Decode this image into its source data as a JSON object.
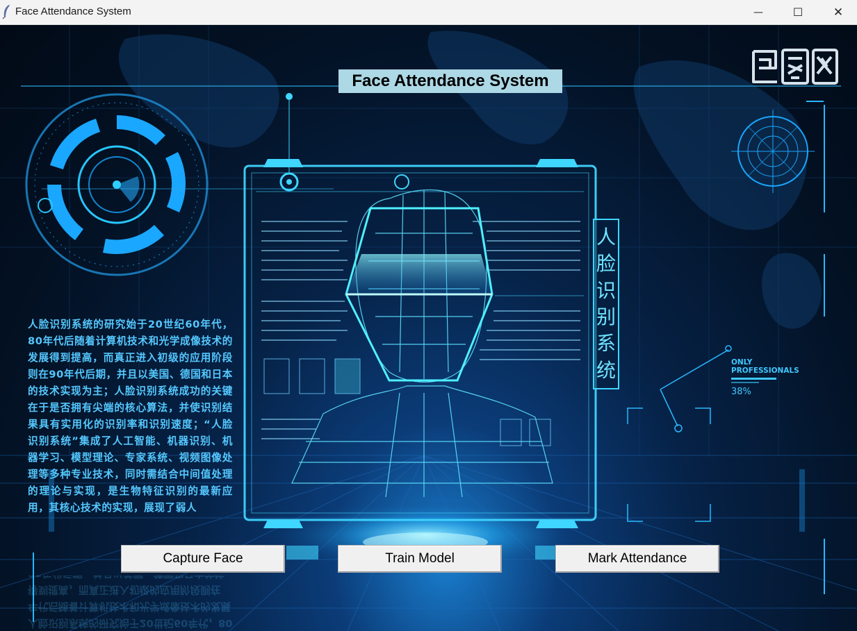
{
  "window": {
    "title": "Face Attendance System",
    "controls": {
      "minimize": "—",
      "maximize": "☐",
      "close": "✕"
    }
  },
  "header": {
    "title": "Face Attendance System"
  },
  "watermark": {
    "text": "包图网"
  },
  "vertical_label": {
    "chars": [
      "人",
      "脸",
      "识",
      "别",
      "系",
      "统"
    ]
  },
  "description": "人脸识别系统的研究始于20世纪60年代，80年代后随着计算机技术和光学成像技术的发展得到提高，而真正进入初级的应用阶段则在90年代后期，并且以美国、德国和日本的技术实现为主；人脸识别系统成功的关键在于是否拥有尖端的核心算法，并使识别结果具有实用化的识别率和识别速度；“人脸识别系统”集成了人工智能、机器识别、机器学习、模型理论、专家系统、视频图像处理等多种专业技术，同时需结合中间值处理的理论与实现，是生物特征识别的最新应用，其核心技术的实现，展现了弱人",
  "hud": {
    "label_line1": "ONLY",
    "label_line2": "PROFESSIONALS",
    "percent": "38%"
  },
  "buttons": {
    "capture": "Capture Face",
    "train": "Train Model",
    "mark": "Mark Attendance"
  },
  "colors": {
    "accent": "#3fd6ff",
    "heading_bg": "#add8e6",
    "text_blue": "#55c8ff",
    "button_bg": "#f0f0f0"
  }
}
